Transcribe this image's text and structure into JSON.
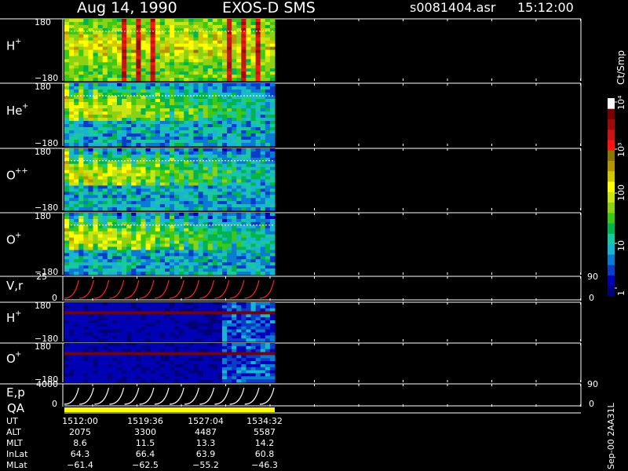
{
  "header": {
    "date": "Aug 14, 1990",
    "instrument": "EXOS-D SMS",
    "file": "s0081404.asr",
    "time": "15:12:00"
  },
  "colorbar": {
    "unit": "Ct/Smp",
    "ticks": [
      "1",
      "10",
      "100",
      "10³",
      "10⁴"
    ],
    "colors": [
      "#00007a",
      "#0000b4",
      "#0a3cc8",
      "#0a7ad2",
      "#1ab4d2",
      "#1ac8a0",
      "#00b450",
      "#3cc814",
      "#8cd214",
      "#c8e614",
      "#ffff00",
      "#d2c800",
      "#b49600",
      "#8c7800",
      "#ff1414",
      "#c81414",
      "#a00a0a",
      "#780000",
      "#ffffff"
    ]
  },
  "chart_data": [
    {
      "type": "heatmap",
      "species": "H",
      "charge": "+",
      "y_ticks": [
        "180",
        "−180"
      ],
      "style": "strong-fold"
    },
    {
      "type": "heatmap",
      "species": "He",
      "charge": "+",
      "y_ticks": [
        "180",
        "−180"
      ],
      "style": "fold"
    },
    {
      "type": "heatmap",
      "species": "O",
      "charge": "++",
      "y_ticks": [
        "180",
        "−180"
      ],
      "style": "fold"
    },
    {
      "type": "heatmap",
      "species": "O",
      "charge": "+",
      "y_ticks": [
        "180",
        "−180"
      ],
      "style": "fold-dense"
    },
    {
      "type": "line",
      "label": "V,r",
      "y_left_ticks": [
        "25",
        "0"
      ],
      "y_right_ticks": [
        "90",
        "0"
      ],
      "color": "#ff2020",
      "n_cycles": 14
    },
    {
      "type": "heatmap",
      "species": "H",
      "charge": "+",
      "y_ticks": [
        "180",
        "−180"
      ],
      "style": "low"
    },
    {
      "type": "heatmap",
      "species": "O",
      "charge": "+",
      "y_ticks": [
        "180",
        "−180"
      ],
      "style": "low"
    },
    {
      "type": "line",
      "label": "E,p",
      "y_left_ticks": [
        "4000",
        "0"
      ],
      "y_right_ticks": [
        "90",
        "0"
      ],
      "color": "#ffffff",
      "n_cycles": 14
    }
  ],
  "qa_label": "QA",
  "qa_color": "#ffff00",
  "orbit_table": {
    "labels": [
      "UT",
      "ALT",
      "MLT",
      "InLat",
      "MLat"
    ],
    "columns": [
      [
        "1512:00",
        "2075",
        "8.6",
        "64.3",
        "−61.4"
      ],
      [
        "1519:36",
        "3300",
        "11.5",
        "66.4",
        "−62.5"
      ],
      [
        "1527:04",
        "4487",
        "13.3",
        "63.9",
        "−55.2"
      ],
      [
        "1534:32",
        "5587",
        "14.2",
        "60.8",
        "−46.3"
      ]
    ]
  },
  "footer_note": "Sep-00  2AA31L"
}
